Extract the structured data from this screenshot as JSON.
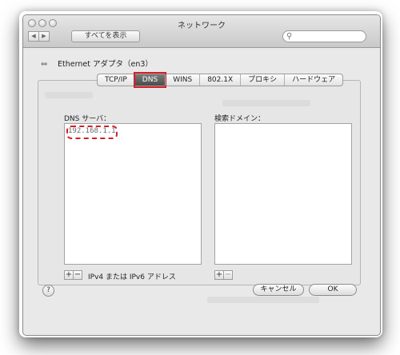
{
  "window": {
    "title": "ネットワーク"
  },
  "toolbar": {
    "show_all_label": "すべてを表示",
    "back_glyph": "◀",
    "forward_glyph": "▶",
    "search_placeholder": ""
  },
  "adapter": {
    "icon_glyph": "⇔",
    "label": "Ethernet アダプタ（en3）"
  },
  "tabs": [
    {
      "label": "TCP/IP",
      "active": false
    },
    {
      "label": "DNS",
      "active": true
    },
    {
      "label": "WINS",
      "active": false
    },
    {
      "label": "802.1X",
      "active": false
    },
    {
      "label": "プロキシ",
      "active": false
    },
    {
      "label": "ハードウェア",
      "active": false
    }
  ],
  "dns": {
    "label": "DNS サーバ：",
    "entries": [
      "192.168.1.1"
    ],
    "hint": "IPv4 または IPv6 アドレス"
  },
  "search_domains": {
    "label": "検索ドメイン：",
    "entries": []
  },
  "controls": {
    "add": "+",
    "remove": "−",
    "help": "?"
  },
  "buttons": {
    "cancel": "キャンセル",
    "ok": "OK"
  },
  "colors": {
    "annotation": "#d3202a",
    "window_bg": "#e9e9e9"
  }
}
